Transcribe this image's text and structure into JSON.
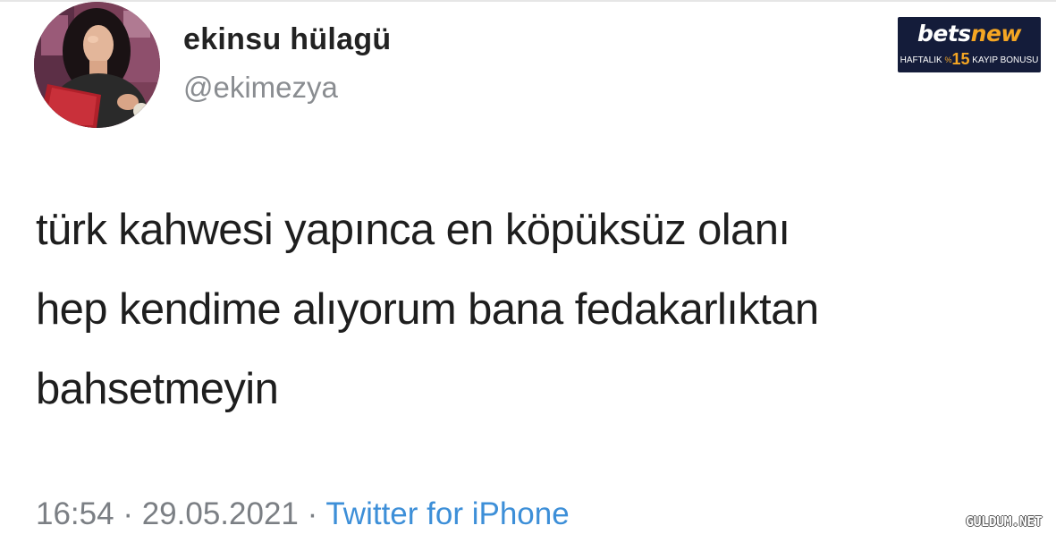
{
  "author": {
    "display_name": "ekinsu hülagü",
    "handle": "@ekimezya"
  },
  "tweet": {
    "lines": [
      "türk kahwesi yapınca en köpüksüz olanı",
      "hep kendime alıyorum bana fedakarlıktan",
      "bahsetmeyin"
    ]
  },
  "meta": {
    "time": "16:54",
    "separator": " · ",
    "date": "29.05.2021",
    "source": "Twitter for iPhone"
  },
  "ad": {
    "brand_part1": "bets",
    "brand_part2": "new",
    "sub_left": "HAFTALIK ",
    "sub_pct": "%",
    "sub_num": "15",
    "sub_right": " KAYIP BONUSU"
  },
  "watermark": "GULDUM.NET",
  "colors": {
    "source_link": "#3d8fd8",
    "meta_gray": "#7b7f84",
    "ad_background": "#141c3a",
    "ad_accent": "#f5a623"
  }
}
